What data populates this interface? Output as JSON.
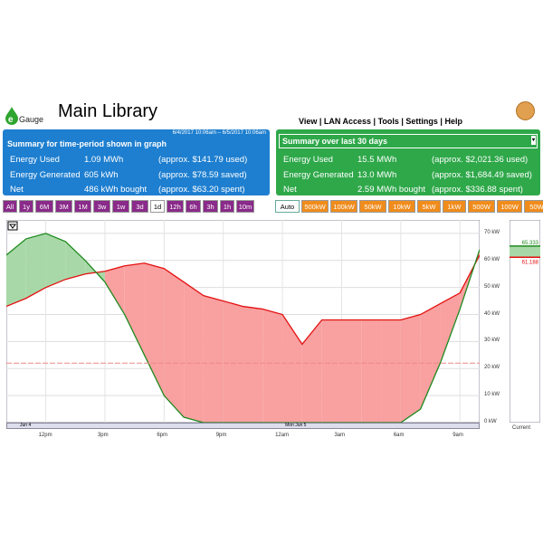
{
  "header": {
    "logo_text": "Gauge",
    "title": "Main Library",
    "menu": "View | LAN Access | Tools | Settings | Help"
  },
  "summary_period": {
    "range": "6/4/2017 10:06am – 6/5/2017 10:06am",
    "title": "Summary for time-period shown in graph",
    "rows": [
      {
        "label": "Energy Used",
        "value": "1.09 MWh",
        "cost": "(approx. $141.79 used)"
      },
      {
        "label": "Energy Generated",
        "value": "605 kWh",
        "cost": "(approx. $78.59 saved)"
      },
      {
        "label": "Net",
        "value": "486 kWh bought",
        "cost": "(approx. $63.20 spent)"
      }
    ]
  },
  "summary_30": {
    "title": "Summary over last 30 days",
    "rows": [
      {
        "label": "Energy Used",
        "value": "15.5 MWh",
        "cost": "(approx. $2,021.36 used)"
      },
      {
        "label": "Energy Generated",
        "value": "13.0 MWh",
        "cost": "(approx. $1,684.49 saved)"
      },
      {
        "label": "Net",
        "value": "2.59 MWh bought",
        "cost": "(approx. $336.88 spent)"
      }
    ]
  },
  "time_buttons": [
    "All",
    "1y",
    "6M",
    "3M",
    "1M",
    "3w",
    "1w",
    "3d",
    "1d",
    "12h",
    "6h",
    "3h",
    "1h",
    "10m"
  ],
  "time_selected": "1d",
  "scale_buttons": [
    "Auto",
    "500kW",
    "100kW",
    "50kW",
    "10kW",
    "5kW",
    "1kW",
    "500W",
    "100W",
    "50W"
  ],
  "scale_selected": "Auto",
  "colors": {
    "used": "#e31010",
    "generated": "#1e8a1e",
    "used_fill": "#f9a0a0",
    "gen_fill": "#a8d8a8"
  },
  "chart_data": {
    "type": "area",
    "ylabel": "kW",
    "ylim": [
      0,
      75
    ],
    "yticks": [
      "0 kW",
      "10 kW",
      "20 kW",
      "30 kW",
      "40 kW",
      "50 kW",
      "60 kW",
      "70 kW"
    ],
    "xticks": [
      "12pm",
      "3pm",
      "6pm",
      "9pm",
      "12am",
      "3am",
      "6am",
      "9am"
    ],
    "date_labels": [
      "Jun 4",
      "Mon Jun 5"
    ],
    "x_hours": [
      0,
      1,
      2,
      3,
      4,
      5,
      6,
      7,
      8,
      9,
      10,
      11,
      12,
      13,
      14,
      15,
      16,
      17,
      18,
      19,
      20,
      21,
      22,
      23,
      24
    ],
    "series": [
      {
        "name": "Generated",
        "values": [
          62,
          68,
          70,
          67,
          60,
          52,
          40,
          25,
          10,
          2,
          0,
          0,
          0,
          0,
          0,
          0,
          0,
          0,
          0,
          0,
          0,
          5,
          22,
          42,
          64
        ]
      },
      {
        "name": "Used",
        "values": [
          43,
          46,
          50,
          53,
          55,
          56,
          58,
          59,
          57,
          52,
          47,
          45,
          43,
          42,
          40,
          29,
          38,
          38,
          38,
          38,
          38,
          40,
          44,
          48,
          62
        ]
      }
    ],
    "current": {
      "generated": "65.333",
      "used": "61.188"
    },
    "current_label": "Current"
  }
}
